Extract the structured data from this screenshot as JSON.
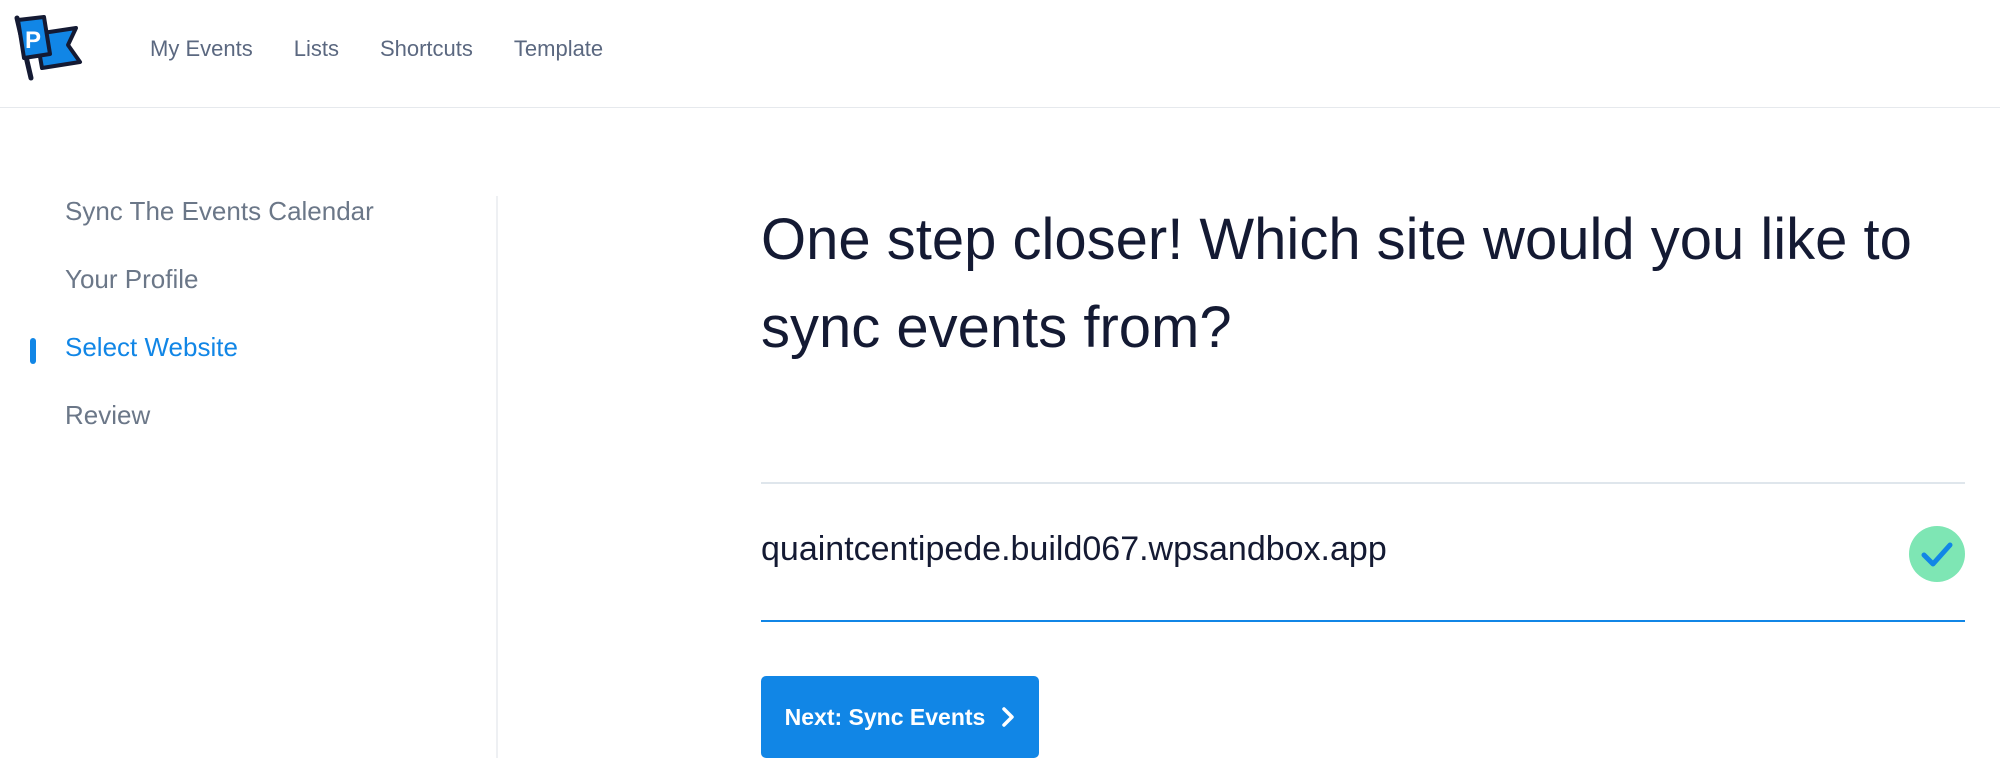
{
  "colors": {
    "accent": "#1186e6",
    "text_dark": "#141a33",
    "text_muted": "#6b7788",
    "nav_text": "#5b6880",
    "success": "#7ee6b4"
  },
  "header": {
    "logo_icon": "flag-logo-icon",
    "logo_letter": "P",
    "nav": [
      {
        "label": "My Events"
      },
      {
        "label": "Lists"
      },
      {
        "label": "Shortcuts"
      },
      {
        "label": "Template"
      }
    ]
  },
  "sidebar": {
    "items": [
      {
        "label": "Sync The Events Calendar",
        "active": false
      },
      {
        "label": "Your Profile",
        "active": false
      },
      {
        "label": "Select Website",
        "active": true
      },
      {
        "label": "Review",
        "active": false
      }
    ]
  },
  "main": {
    "title": "One step closer! Which site would you like to sync events from?",
    "site": {
      "name": "quaintcentipede.build067.wpsandbox.app",
      "selected": true,
      "icon": "checkmark-icon"
    },
    "next_button": {
      "label": "Next: Sync Events",
      "icon": "chevron-right-icon"
    }
  }
}
